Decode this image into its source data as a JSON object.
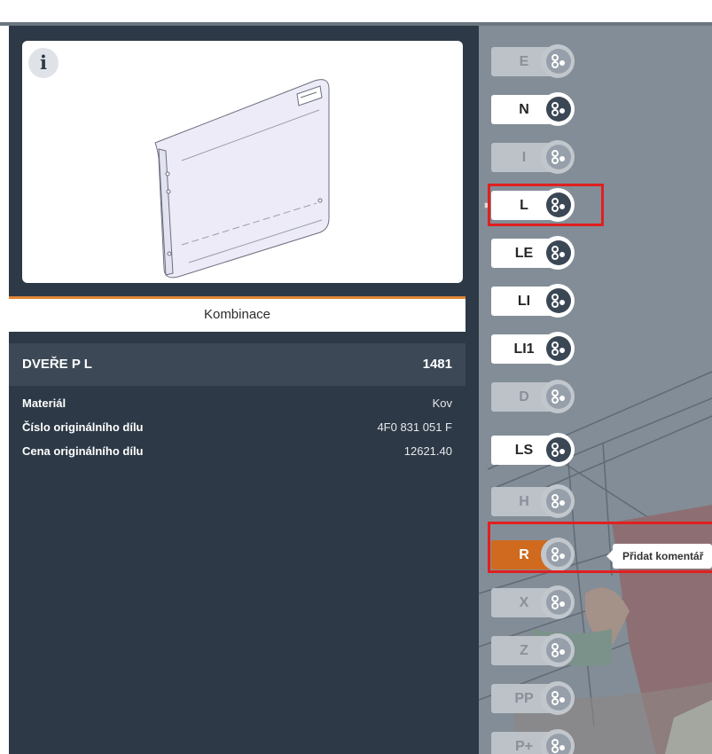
{
  "part_panel": {
    "info_icon": "i",
    "combination_tab": "Kombinace",
    "part_name": "DVEŘE P L",
    "part_code": "1481",
    "details": [
      {
        "label": "Materiál",
        "value": "Kov"
      },
      {
        "label": "Číslo originálního dílu",
        "value": "4F0 831 051 F"
      },
      {
        "label": "Cena originálního dílu",
        "value": "12621.40"
      }
    ]
  },
  "operations": [
    {
      "code": "E",
      "state": "dim"
    },
    {
      "code": "N",
      "state": "normal"
    },
    {
      "code": "I",
      "state": "dim"
    },
    {
      "code": "L",
      "state": "normal",
      "bullet": true,
      "highlighted": true
    },
    {
      "code": "LE",
      "state": "normal"
    },
    {
      "code": "LI",
      "state": "normal"
    },
    {
      "code": "LI1",
      "state": "normal"
    },
    {
      "code": "D",
      "state": "dim"
    },
    {
      "code": "LS",
      "state": "normal"
    },
    {
      "code": "H",
      "state": "dim"
    },
    {
      "code": "R",
      "state": "active",
      "highlighted": true
    },
    {
      "code": "X",
      "state": "dim"
    },
    {
      "code": "Z",
      "state": "dim"
    },
    {
      "code": "PP",
      "state": "dim"
    },
    {
      "code": "P+",
      "state": "dim"
    }
  ],
  "tooltip": "Přidat komentář",
  "colors": {
    "panel": "#2d3946",
    "accent": "#cf6a1e",
    "highlight": "#e02020"
  }
}
